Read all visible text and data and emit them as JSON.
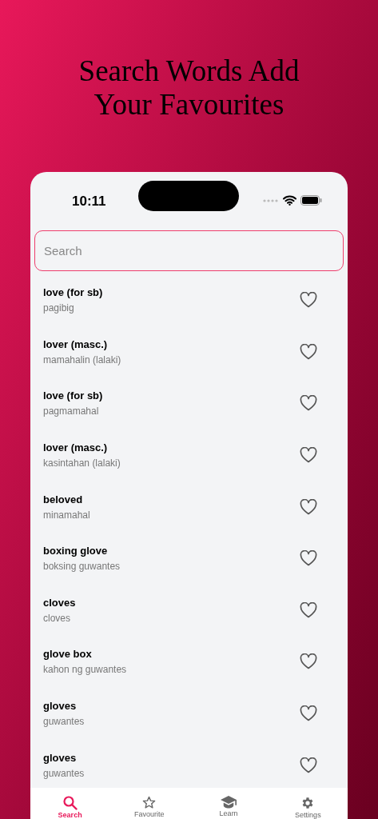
{
  "headline": "Search Words Add Your Favourites",
  "status_bar": {
    "time": "10:11"
  },
  "search": {
    "placeholder": "Search"
  },
  "words": [
    {
      "term": "love (for sb)",
      "translation": "pagibig"
    },
    {
      "term": "lover (masc.)",
      "translation": "mamahalin (lalaki)"
    },
    {
      "term": "love (for sb)",
      "translation": "pagmamahal"
    },
    {
      "term": "lover (masc.)",
      "translation": "kasintahan (lalaki)"
    },
    {
      "term": "beloved",
      "translation": "minamahal"
    },
    {
      "term": "boxing glove",
      "translation": "boksing guwantes"
    },
    {
      "term": "cloves",
      "translation": "cloves"
    },
    {
      "term": "glove box",
      "translation": "kahon ng guwantes"
    },
    {
      "term": "gloves",
      "translation": "guwantes"
    },
    {
      "term": "gloves",
      "translation": "guwantes"
    }
  ],
  "tabs": [
    {
      "kind": "search",
      "label": "Search",
      "selected": true
    },
    {
      "kind": "star",
      "label": "Favourite",
      "selected": false
    },
    {
      "kind": "cap",
      "label": "Learn",
      "selected": false
    },
    {
      "kind": "gear",
      "label": "Settings",
      "selected": false
    }
  ]
}
